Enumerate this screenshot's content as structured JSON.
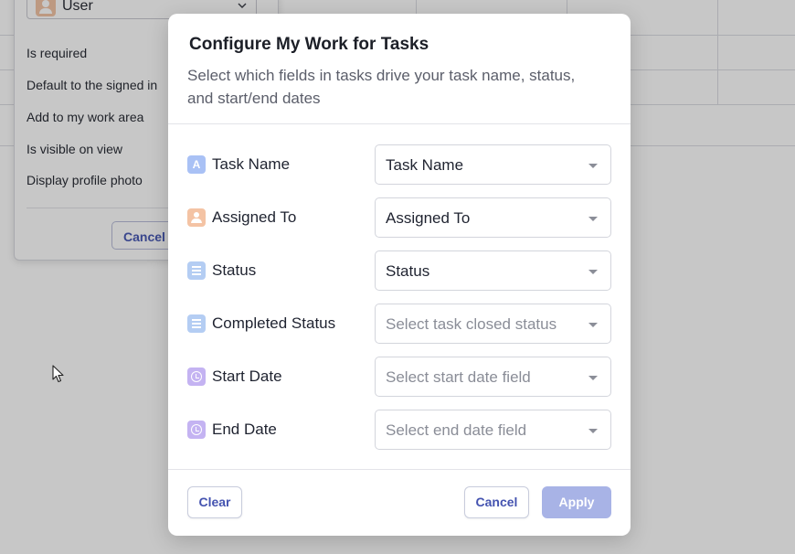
{
  "background": {
    "select_value": "User",
    "options": [
      "Is required",
      "Default to the signed in",
      "Add to my work area",
      "Is visible on view",
      "Display profile photo"
    ],
    "cancel_label": "Cancel"
  },
  "modal": {
    "title": "Configure My Work for Tasks",
    "subtitle": "Select which fields in tasks drive your task name, status, and start/end dates",
    "rows": [
      {
        "label": "Task Name",
        "icon": "text-field-icon",
        "icon_glyph": "A",
        "value": "Task Name",
        "placeholder": false
      },
      {
        "label": "Assigned To",
        "icon": "user-field-icon",
        "value": "Assigned To",
        "placeholder": false
      },
      {
        "label": "Status",
        "icon": "list-field-icon",
        "value": "Status",
        "placeholder": false
      },
      {
        "label": "Completed Status",
        "icon": "list-field-icon",
        "value": "Select task closed status",
        "placeholder": true
      },
      {
        "label": "Start Date",
        "icon": "clock-field-icon",
        "value": "Select start date field",
        "placeholder": true
      },
      {
        "label": "End Date",
        "icon": "clock-field-icon",
        "value": "Select end date field",
        "placeholder": true
      }
    ],
    "footer": {
      "clear_label": "Clear",
      "cancel_label": "Cancel",
      "apply_label": "Apply"
    }
  },
  "colors": {
    "accent": "#4453b0",
    "apply_disabled": "#a8b3e6"
  }
}
